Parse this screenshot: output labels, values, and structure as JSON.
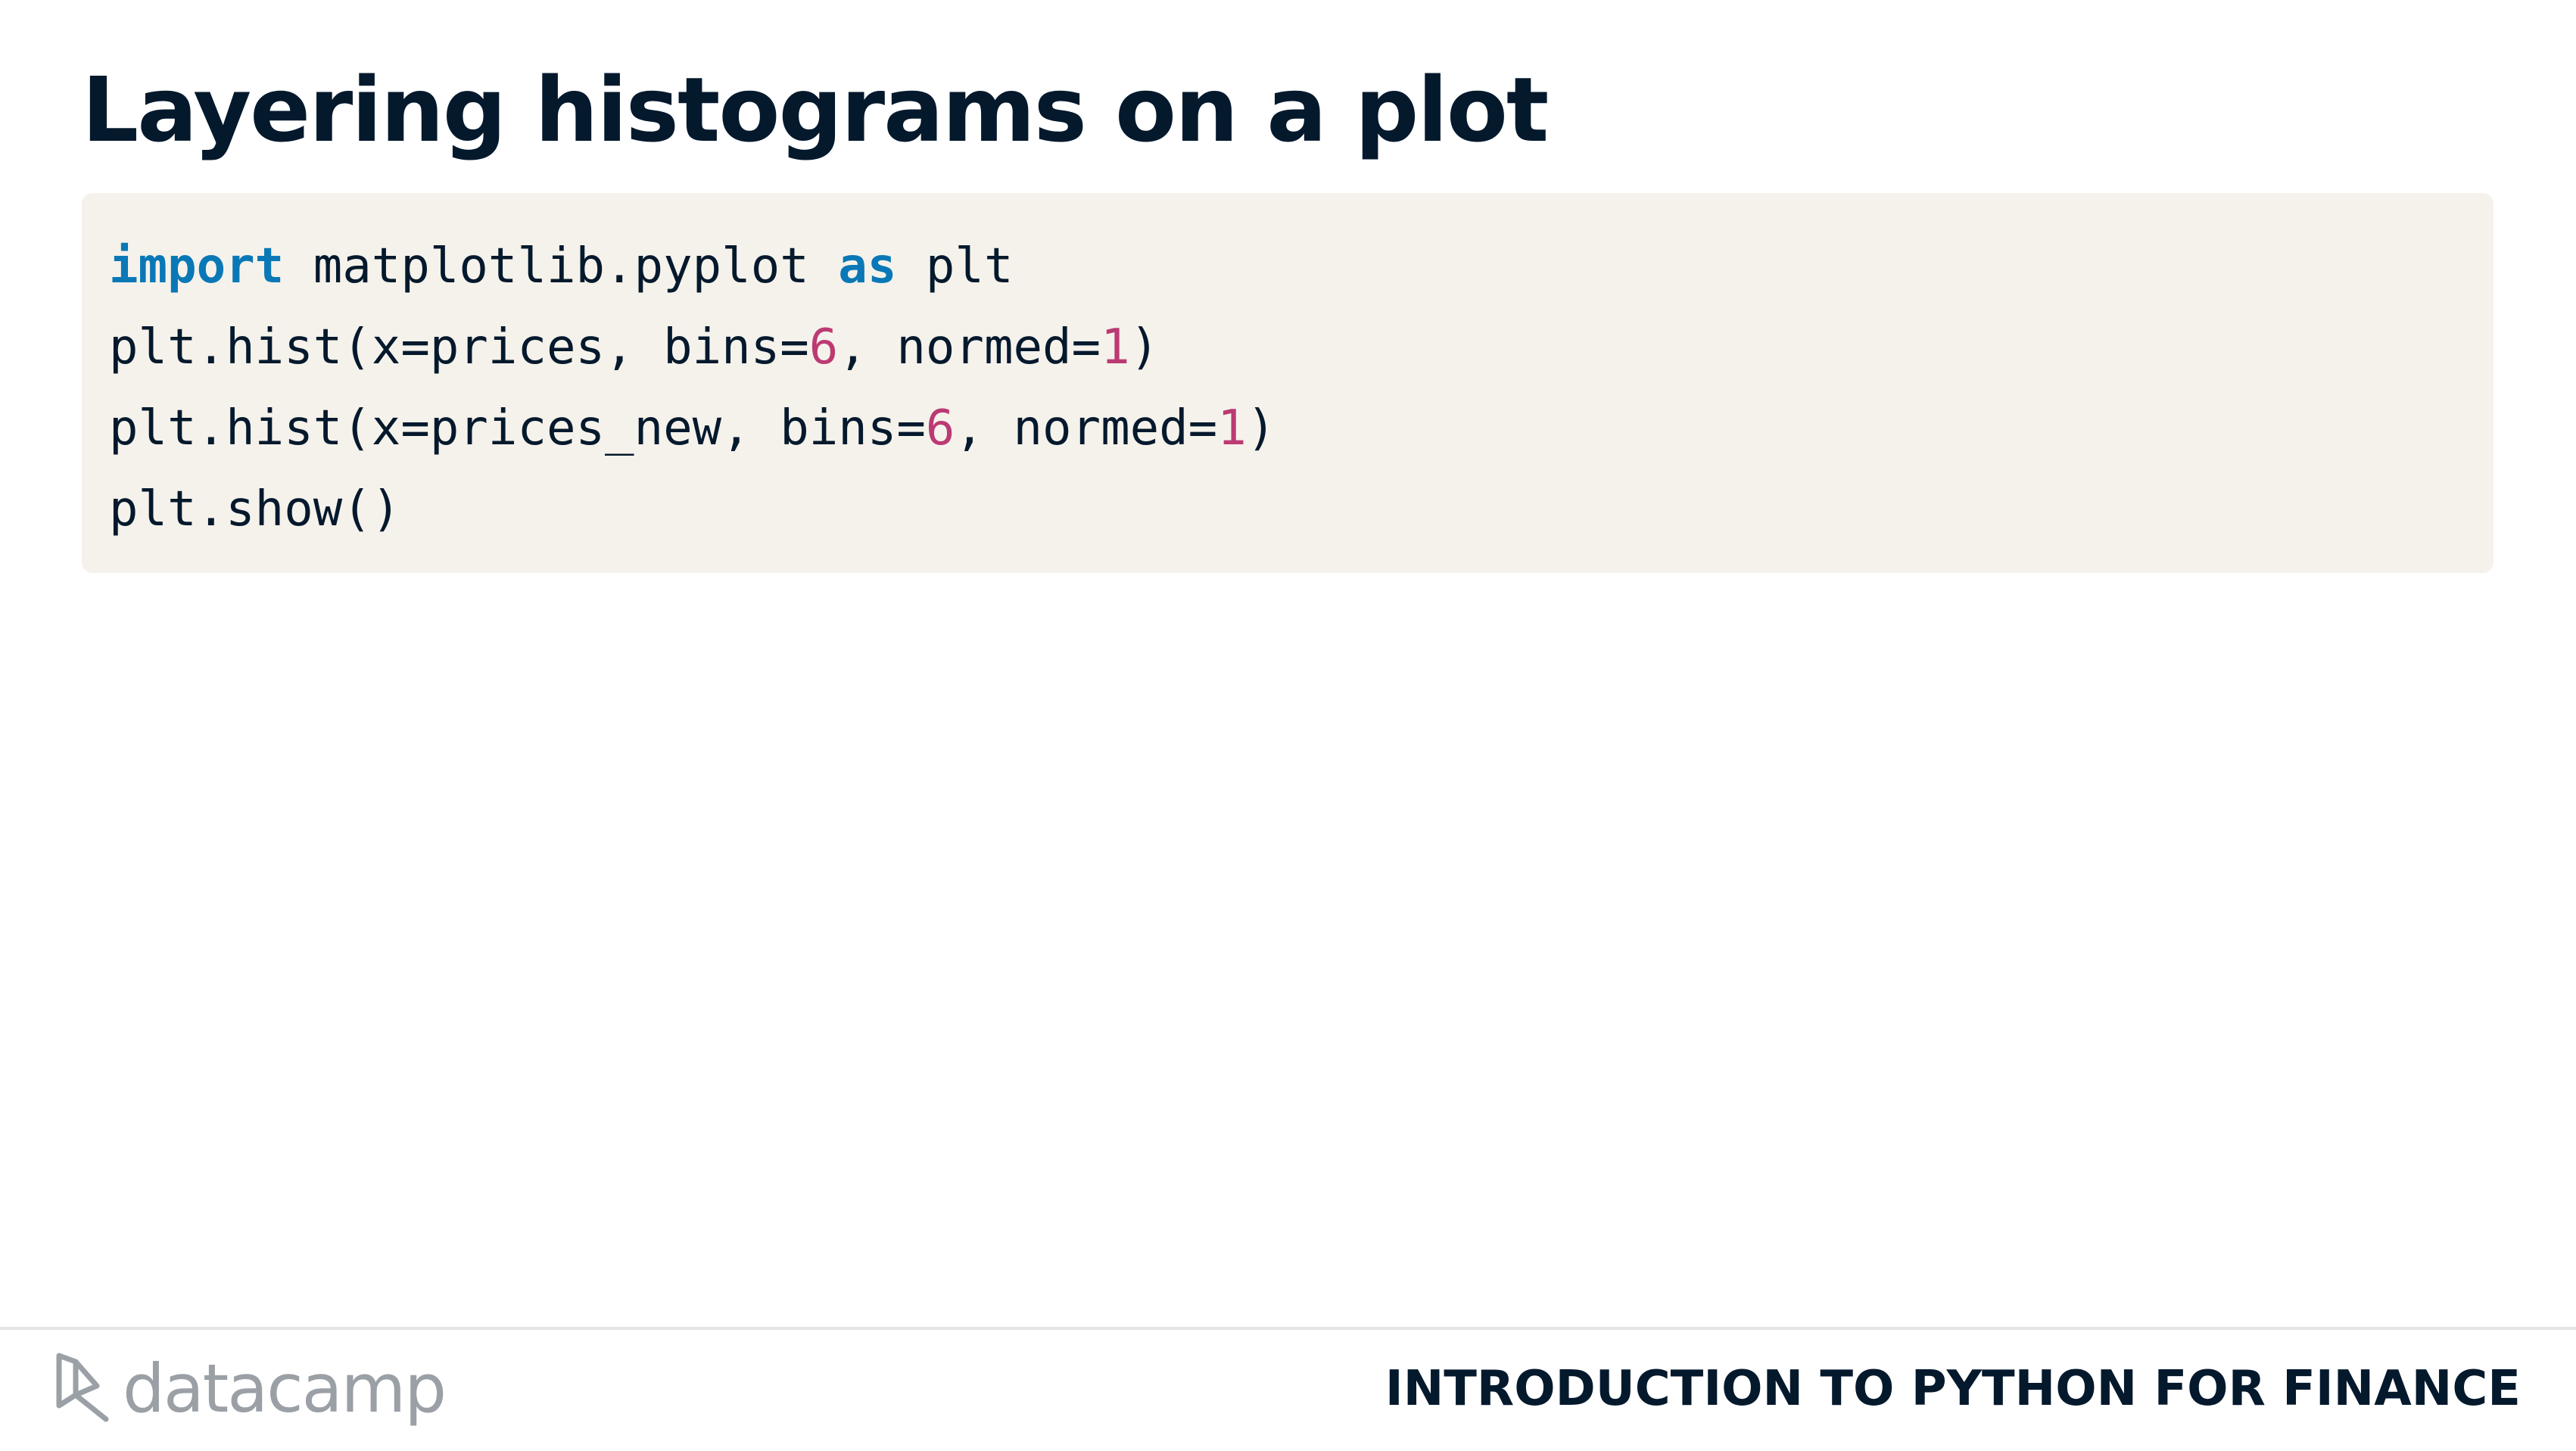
{
  "slide": {
    "title": "Layering histograms on a plot"
  },
  "code": {
    "line1": {
      "kw_import": "import",
      "module": " matplotlib.pyplot ",
      "kw_as": "as",
      "alias": " plt"
    },
    "line2": {
      "pre": "plt.hist(x=prices, bins=",
      "num_bins": "6",
      "mid": ", normed=",
      "num_normed": "1",
      "post": ")"
    },
    "line3": {
      "pre": "plt.hist(x=prices_new, bins=",
      "num_bins": "6",
      "mid": ", normed=",
      "num_normed": "1",
      "post": ")"
    },
    "line4": {
      "text": "plt.show()"
    }
  },
  "footer": {
    "logo_text": "datacamp",
    "course_name": "INTRODUCTION TO PYTHON FOR FINANCE"
  },
  "colors": {
    "heading": "#05192d",
    "keyword": "#0a78b6",
    "number": "#bc3a73",
    "code_background": "#f5f2eb",
    "logo": "#9aa0a6"
  }
}
